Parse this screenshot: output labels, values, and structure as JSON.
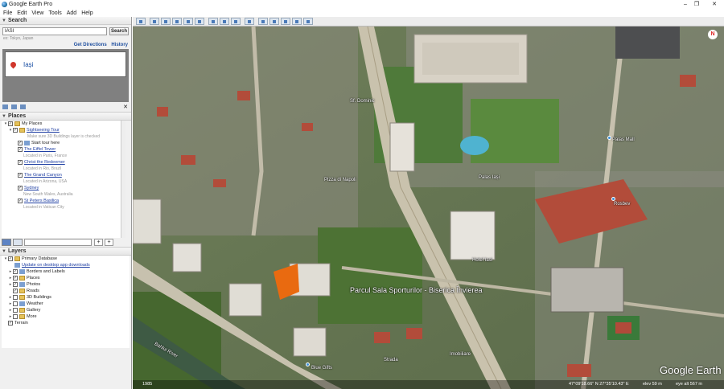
{
  "window": {
    "title": "Google Earth Pro",
    "controls": [
      "–",
      "❐",
      "✕"
    ]
  },
  "menu": [
    "File",
    "Edit",
    "View",
    "Tools",
    "Add",
    "Help"
  ],
  "search": {
    "section_label": "Search",
    "query": "IASI",
    "button": "Search",
    "hint": "ex: Tokyo, Japan",
    "get_directions": "Get Directions",
    "history": "History",
    "result": "Iași"
  },
  "places": {
    "section_label": "Places",
    "items": [
      {
        "label": "My Places",
        "kind": "folder"
      },
      {
        "label": "Sightseeing Tour",
        "kind": "folder",
        "link": true,
        "desc": "Make sure 3D Buildings layer is checked"
      },
      {
        "label": "Start tour here",
        "kind": "tour"
      },
      {
        "label": "The Eiffel Tower",
        "kind": "place",
        "desc": "Located in Paris, France"
      },
      {
        "label": "Christ the Redeemer",
        "kind": "place",
        "desc": "Located in Rio, Brazil"
      },
      {
        "label": "The Grand Canyon",
        "kind": "place",
        "desc": "Located in Arizona, USA"
      },
      {
        "label": "Sydney",
        "kind": "place",
        "desc": "New South Wales, Australia"
      },
      {
        "label": "St Peters Basilica",
        "kind": "place",
        "desc": "Located in Vatican City"
      }
    ]
  },
  "layers": {
    "section_label": "Layers",
    "items": [
      {
        "label": "Primary Database"
      },
      {
        "label": "Update on desktop app downloads",
        "link": true
      },
      {
        "label": "Borders and Labels"
      },
      {
        "label": "Places"
      },
      {
        "label": "Photos"
      },
      {
        "label": "Roads"
      },
      {
        "label": "3D Buildings"
      },
      {
        "label": "Weather"
      },
      {
        "label": "Gallery"
      },
      {
        "label": "More"
      },
      {
        "label": "Terrain"
      }
    ]
  },
  "map": {
    "labels": {
      "park": "Parcul Sala Sporturilor - Biserica Învierea",
      "pizza": "Pizza di Napoli",
      "palas": "Palas Mall",
      "river": "Bahlui River",
      "strada": "Strada",
      "blue_gift": "Blue Gifts",
      "imobiliare": "Imobiliare",
      "dominic": "Sf. Dominic",
      "palas_iasi": "Palas Iași",
      "rosbev": "Rosbev",
      "hotel_iasi": "Hotel Iasi"
    },
    "watermark": "Google Earth",
    "status": {
      "year": "1985",
      "coords": "47°09'18.66\" N  27°35'10.43\" E",
      "elev": "elev  59 m",
      "eye_alt": "eye alt  567 m"
    }
  }
}
